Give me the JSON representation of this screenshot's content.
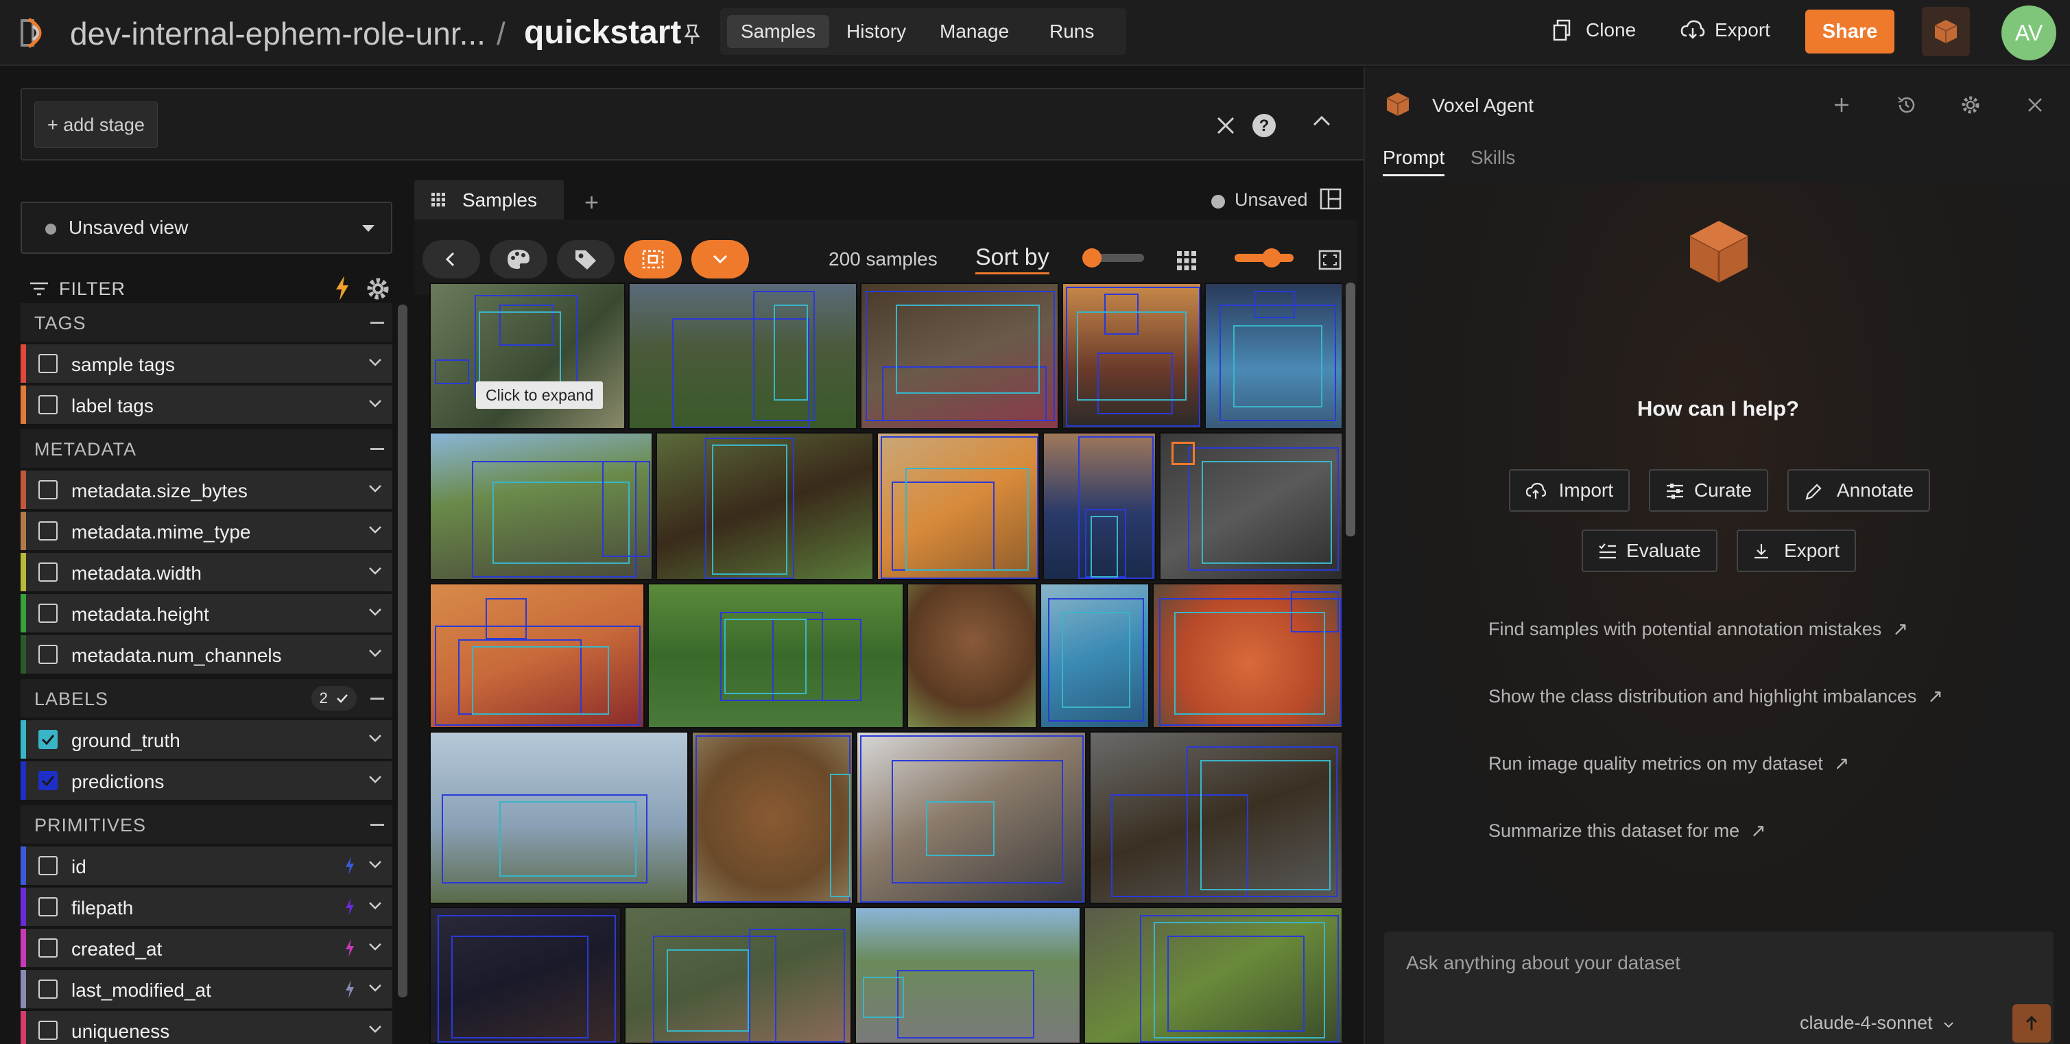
{
  "header": {
    "dataset": "dev-internal-ephem-role-unr...",
    "separator": "/",
    "project": "quickstart",
    "nav": [
      "Samples",
      "History",
      "Manage",
      "Runs"
    ],
    "actions": {
      "clone": "Clone",
      "export": "Export",
      "share": "Share"
    },
    "avatar": "AV",
    "accent": "#f07a2c"
  },
  "viewbar": {
    "add_stage": "+ add stage"
  },
  "sidebar": {
    "view": "Unsaved view",
    "filter": "FILTER",
    "sections": {
      "tags": {
        "label": "TAGS",
        "items": [
          "sample tags",
          "label tags"
        ]
      },
      "metadata": {
        "label": "METADATA",
        "items": [
          "metadata.size_bytes",
          "metadata.mime_type",
          "metadata.width",
          "metadata.height",
          "metadata.num_channels"
        ]
      },
      "labels": {
        "label": "LABELS",
        "badge": "2",
        "items": [
          "ground_truth",
          "predictions"
        ]
      },
      "primitives": {
        "label": "PRIMITIVES",
        "items": [
          "id",
          "filepath",
          "created_at",
          "last_modified_at",
          "uniqueness"
        ]
      }
    }
  },
  "samples": {
    "tab": "Samples",
    "status": "Unsaved",
    "count": "200 samples",
    "sort": "Sort by",
    "tooltip": "Click to expand"
  },
  "agent": {
    "title": "Voxel Agent",
    "tabs": [
      "Prompt",
      "Skills"
    ],
    "greeting": "How can I help?",
    "chips": [
      "Import",
      "Curate",
      "Annotate",
      "Evaluate",
      "Export"
    ],
    "suggestions": [
      "Find samples with potential annotation mistakes",
      "Show the class distribution and highlight imbalances",
      "Run image quality metrics on my dataset",
      "Summarize this dataset for me"
    ],
    "input_placeholder": "Ask anything about your dataset",
    "model": "claude-4-sonnet"
  }
}
